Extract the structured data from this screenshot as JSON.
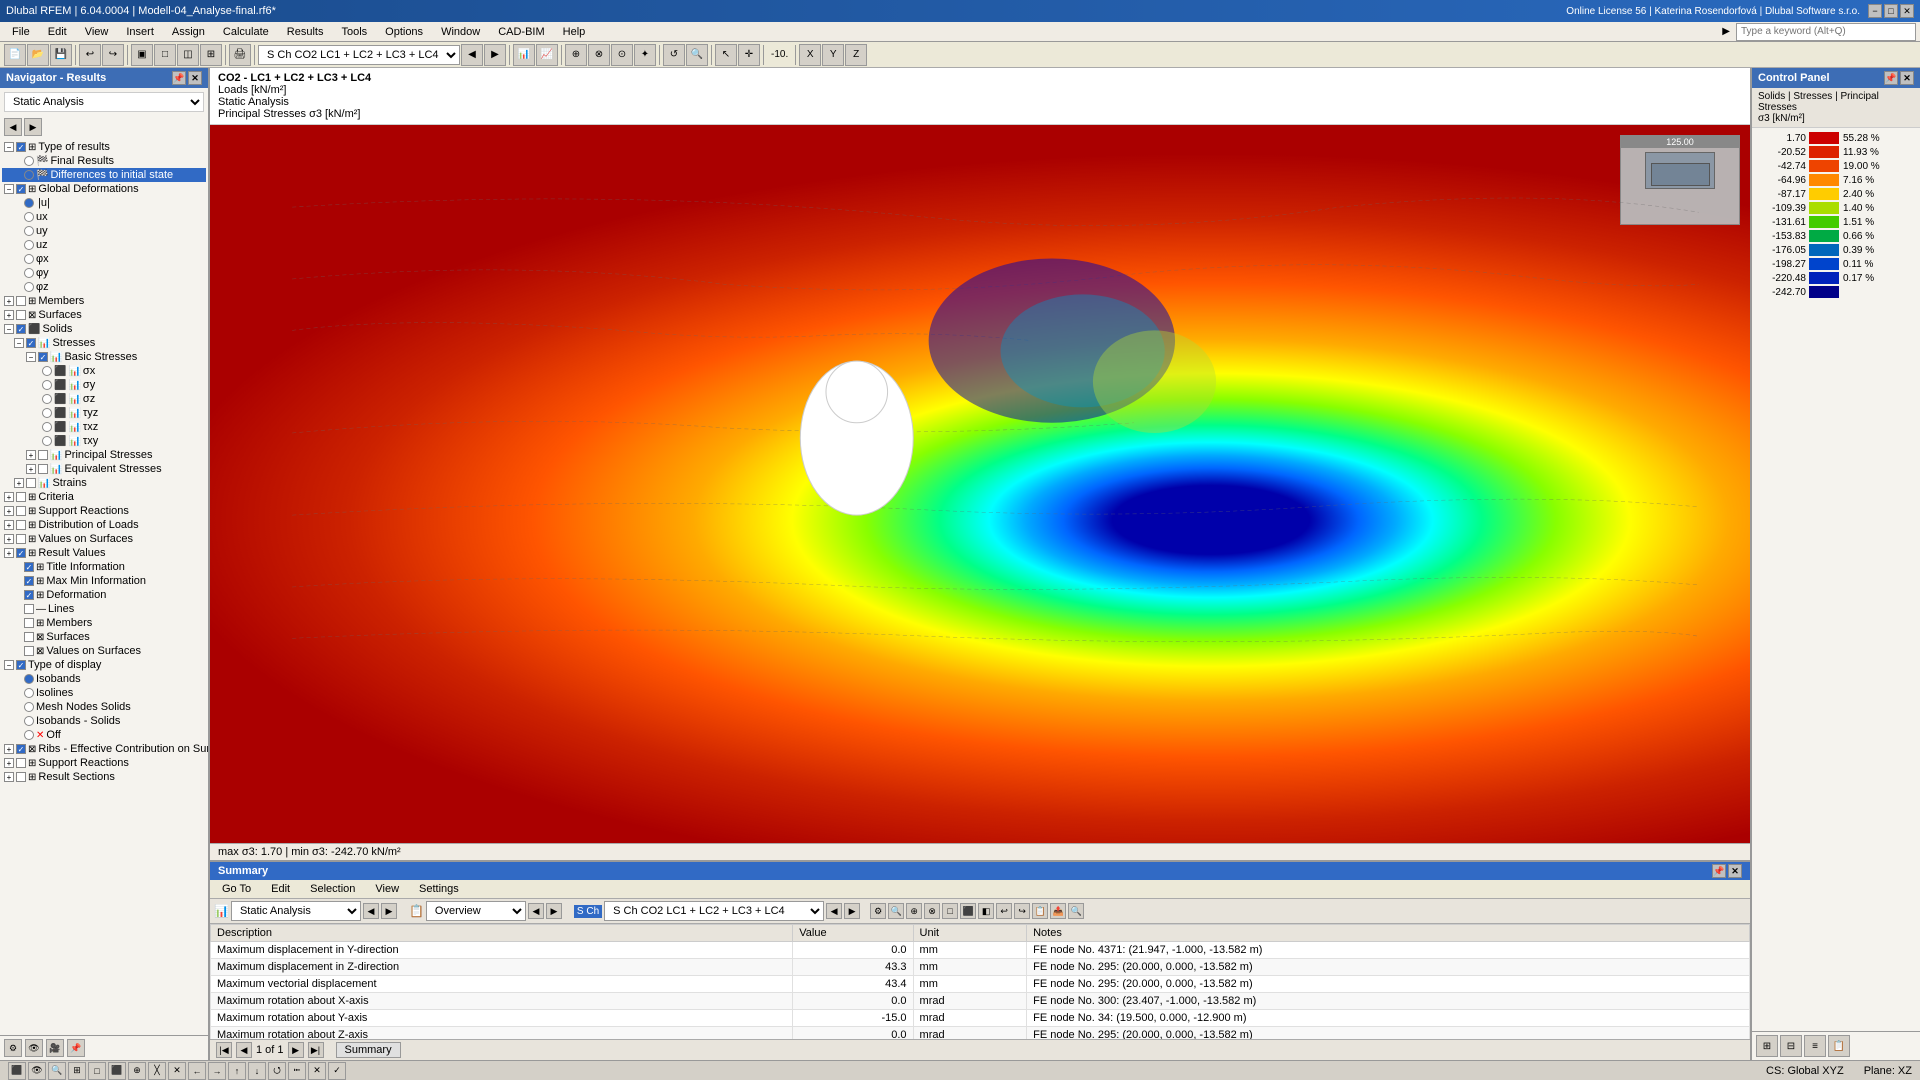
{
  "titlebar": {
    "title": "Dlubal RFEM | 6.04.0004 | Modell-04_Analyse-final.rf6*",
    "license": "Online License 56 | Katerina Rosendorfová | Dlubal Software s.r.o.",
    "search_placeholder": "Type a keyword (Alt+Q)",
    "min": "−",
    "max": "□",
    "close": "✕"
  },
  "menubar": {
    "items": [
      "File",
      "Edit",
      "View",
      "Insert",
      "Assign",
      "Calculate",
      "Results",
      "Tools",
      "Options",
      "Window",
      "CAD-BIM",
      "Help"
    ]
  },
  "navigator": {
    "title": "Navigator - Results",
    "combo_value": "Static Analysis",
    "nav_arrows": [
      "◀",
      "▶"
    ],
    "tree": [
      {
        "label": "Type of results",
        "level": 0,
        "expand": true,
        "checked": true,
        "type": "section"
      },
      {
        "label": "Final Results",
        "level": 1,
        "expand": false,
        "checked": false,
        "type": "radio"
      },
      {
        "label": "Differences to initial state",
        "level": 1,
        "expand": false,
        "checked": true,
        "type": "radio",
        "selected": true
      },
      {
        "label": "Global Deformations",
        "level": 0,
        "expand": true,
        "checked": true,
        "type": "section"
      },
      {
        "label": "|u|",
        "level": 1,
        "expand": false,
        "checked": true,
        "type": "radio",
        "selected": false
      },
      {
        "label": "ux",
        "level": 1,
        "expand": false,
        "checked": false,
        "type": "radio"
      },
      {
        "label": "uy",
        "level": 1,
        "expand": false,
        "checked": false,
        "type": "radio"
      },
      {
        "label": "uz",
        "level": 1,
        "expand": false,
        "checked": false,
        "type": "radio"
      },
      {
        "label": "φx",
        "level": 1,
        "expand": false,
        "checked": false,
        "type": "radio"
      },
      {
        "label": "φy",
        "level": 1,
        "expand": false,
        "checked": false,
        "type": "radio"
      },
      {
        "label": "φz",
        "level": 1,
        "expand": false,
        "checked": false,
        "type": "radio"
      },
      {
        "label": "Members",
        "level": 0,
        "expand": false,
        "checked": false,
        "type": "section"
      },
      {
        "label": "Surfaces",
        "level": 0,
        "expand": false,
        "checked": false,
        "type": "section"
      },
      {
        "label": "Solids",
        "level": 0,
        "expand": true,
        "checked": true,
        "type": "section"
      },
      {
        "label": "Stresses",
        "level": 1,
        "expand": true,
        "checked": true,
        "type": "subsection"
      },
      {
        "label": "Basic Stresses",
        "level": 2,
        "expand": true,
        "checked": true,
        "type": "subsection"
      },
      {
        "label": "σx",
        "level": 3,
        "expand": false,
        "checked": false,
        "type": "radio"
      },
      {
        "label": "σy",
        "level": 3,
        "expand": false,
        "checked": false,
        "type": "radio"
      },
      {
        "label": "σz",
        "level": 3,
        "expand": false,
        "checked": false,
        "type": "radio"
      },
      {
        "label": "τyz",
        "level": 3,
        "expand": false,
        "checked": false,
        "type": "radio"
      },
      {
        "label": "τxz",
        "level": 3,
        "expand": false,
        "checked": false,
        "type": "radio"
      },
      {
        "label": "τxy",
        "level": 3,
        "expand": false,
        "checked": false,
        "type": "radio"
      },
      {
        "label": "Principal Stresses",
        "level": 2,
        "expand": false,
        "checked": false,
        "type": "subsection"
      },
      {
        "label": "Equivalent Stresses",
        "level": 2,
        "expand": false,
        "checked": false,
        "type": "subsection"
      },
      {
        "label": "Strains",
        "level": 1,
        "expand": false,
        "checked": false,
        "type": "subsection"
      },
      {
        "label": "Criteria",
        "level": 0,
        "expand": false,
        "checked": false,
        "type": "section"
      },
      {
        "label": "Support Reactions",
        "level": 0,
        "expand": false,
        "checked": false,
        "type": "section"
      },
      {
        "label": "Distribution of Loads",
        "level": 0,
        "expand": false,
        "checked": false,
        "type": "section"
      },
      {
        "label": "Values on Surfaces",
        "level": 0,
        "expand": false,
        "checked": false,
        "type": "section"
      },
      {
        "label": "Result Values",
        "level": 0,
        "expand": false,
        "checked": true,
        "type": "section-check"
      },
      {
        "label": "Title Information",
        "level": 1,
        "expand": false,
        "checked": true,
        "type": "check"
      },
      {
        "label": "Max/Min Information",
        "level": 1,
        "expand": false,
        "checked": true,
        "type": "check"
      },
      {
        "label": "Deformation",
        "level": 1,
        "expand": false,
        "checked": true,
        "type": "check"
      },
      {
        "label": "Lines",
        "level": 1,
        "expand": false,
        "checked": false,
        "type": "check"
      },
      {
        "label": "Members",
        "level": 1,
        "expand": false,
        "checked": false,
        "type": "check"
      },
      {
        "label": "Surfaces",
        "level": 1,
        "expand": false,
        "checked": false,
        "type": "check"
      },
      {
        "label": "Values on Surfaces",
        "level": 1,
        "expand": false,
        "checked": false,
        "type": "check"
      },
      {
        "label": "Type of display",
        "level": 0,
        "expand": true,
        "checked": true,
        "type": "section"
      },
      {
        "label": "Isobands",
        "level": 1,
        "expand": false,
        "checked": true,
        "type": "radio",
        "selected": true
      },
      {
        "label": "Isolines",
        "level": 1,
        "expand": false,
        "checked": false,
        "type": "radio"
      },
      {
        "label": "Mesh Nodes Solids",
        "level": 1,
        "expand": false,
        "checked": false,
        "type": "radio"
      },
      {
        "label": "Isobands - Solids",
        "level": 1,
        "expand": false,
        "checked": false,
        "type": "radio"
      },
      {
        "label": "Off",
        "level": 1,
        "expand": false,
        "checked": false,
        "type": "radio"
      },
      {
        "label": "Ribs - Effective Contribution on Surfa...",
        "level": 0,
        "expand": false,
        "checked": true,
        "type": "section-check"
      },
      {
        "label": "Support Reactions",
        "level": 0,
        "expand": false,
        "checked": false,
        "type": "section"
      },
      {
        "label": "Result Sections",
        "level": 0,
        "expand": false,
        "checked": false,
        "type": "section"
      }
    ],
    "bottom_tools": [
      "🔍",
      "👁",
      "🎥",
      "📌"
    ]
  },
  "viewport": {
    "combo_label": "CO2 - LC1 + LC2 + LC3 + LC4",
    "nav_arrows": [
      "◀",
      "▶"
    ],
    "combo_icons": [
      "📊"
    ],
    "info_line1": "CO2 - LC1 + LC2 + LC3 + LC4",
    "info_line2": "Loads [kN/m²]",
    "info_line3": "Static Analysis",
    "info_line4": "Principal Stresses σ3 [kN/m²]",
    "bottom_label": "max σ3: 1.70 | min σ3: -242.70 kN/m²",
    "minimap_label": "125.00"
  },
  "legend": {
    "title": "Control Panel",
    "subtitle": "Solids | Stresses | Principal Stresses\nσ3 [kN/m²]",
    "entries": [
      {
        "value": "1.70",
        "color": "#cc0000",
        "pct": "55.28 %"
      },
      {
        "value": "-20.52",
        "color": "#dd2200",
        "pct": "11.93 %"
      },
      {
        "value": "-42.74",
        "color": "#ee4400",
        "pct": "19.00 %"
      },
      {
        "value": "-64.96",
        "color": "#ff8800",
        "pct": "7.16 %"
      },
      {
        "value": "-87.17",
        "color": "#ffcc00",
        "pct": "2.40 %"
      },
      {
        "value": "-109.39",
        "color": "#aadd00",
        "pct": "1.40 %"
      },
      {
        "value": "-131.61",
        "color": "#44cc00",
        "pct": "1.51 %"
      },
      {
        "value": "-153.83",
        "color": "#00aa44",
        "pct": "0.66 %"
      },
      {
        "value": "-176.05",
        "color": "#0066bb",
        "pct": "0.39 %"
      },
      {
        "value": "-198.27",
        "color": "#0044cc",
        "pct": "0.11 %"
      },
      {
        "value": "-220.48",
        "color": "#0022bb",
        "pct": "0.17 %"
      },
      {
        "value": "-242.70",
        "color": "#000088",
        "pct": ""
      }
    ]
  },
  "summary": {
    "title": "Summary",
    "menus": [
      "Go To",
      "Edit",
      "Selection",
      "View",
      "Settings"
    ],
    "combo1_label": "Static Analysis",
    "combo2_label": "Overview",
    "load_combo": "S Ch  CO2   LC1 + LC2 + LC3 + LC4",
    "nav_arrows": [
      "◀",
      "▶"
    ],
    "columns": [
      "Description",
      "Value",
      "Unit",
      "Notes"
    ],
    "rows": [
      {
        "desc": "Maximum displacement in Y-direction",
        "value": "0.0",
        "unit": "mm",
        "note": "FE node No. 4371: (21.947, -1.000, -13.582 m)"
      },
      {
        "desc": "Maximum displacement in Z-direction",
        "value": "43.3",
        "unit": "mm",
        "note": "FE node No. 295: (20.000, 0.000, -13.582 m)"
      },
      {
        "desc": "Maximum vectorial displacement",
        "value": "43.4",
        "unit": "mm",
        "note": "FE node No. 295: (20.000, 0.000, -13.582 m)"
      },
      {
        "desc": "Maximum rotation about X-axis",
        "value": "0.0",
        "unit": "mrad",
        "note": "FE node No. 300: (23.407, -1.000, -13.582 m)"
      },
      {
        "desc": "Maximum rotation about Y-axis",
        "value": "-15.0",
        "unit": "mrad",
        "note": "FE node No. 34: (19.500, 0.000, -12.900 m)"
      },
      {
        "desc": "Maximum rotation about Z-axis",
        "value": "0.0",
        "unit": "mrad",
        "note": "FE node No. 295: (20.000, 0.000, -13.582 m)"
      }
    ],
    "page_info": "1 of 1",
    "tab_label": "Summary"
  },
  "statusbar": {
    "cs": "CS: Global XYZ",
    "plane": "Plane: XZ"
  },
  "toolbar_combo": "S Ch  CO2   LC1 + LC2 + LC3 + LC4",
  "toolbar_nav_arrows": [
    "◀",
    "▶"
  ]
}
